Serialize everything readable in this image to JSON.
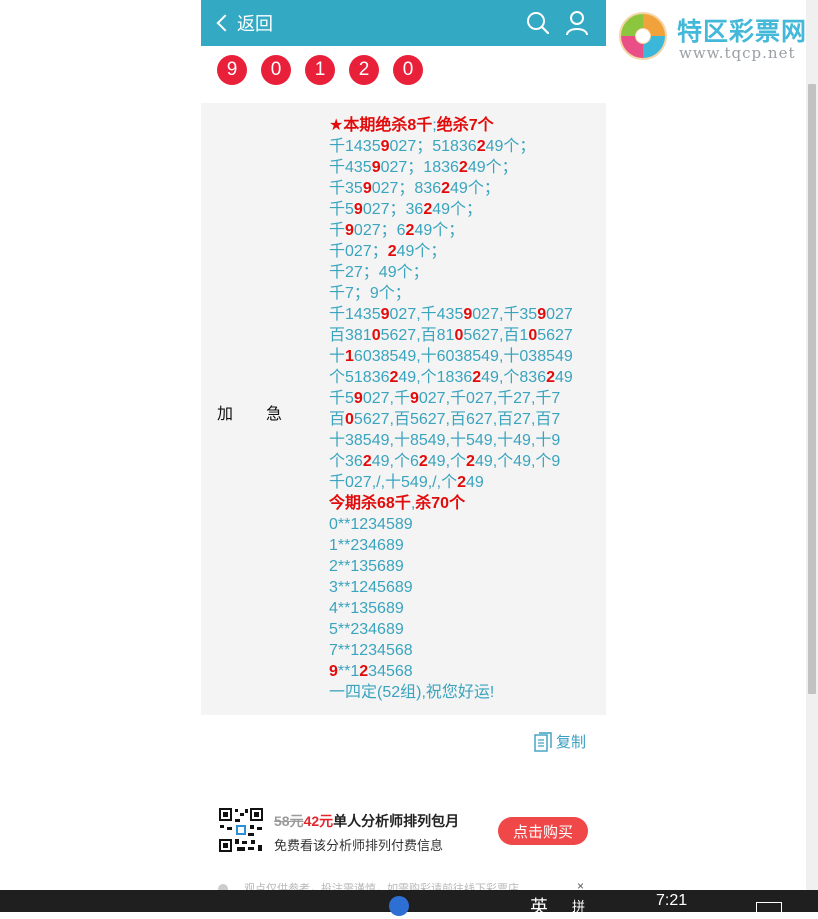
{
  "header": {
    "back_label": "返回",
    "bg_color": "#33a9c4"
  },
  "logo": {
    "name": "特区彩票网",
    "url": "www.tqcp.net"
  },
  "numbers": [
    "9",
    "0",
    "1",
    "2",
    "0"
  ],
  "label": [
    "加",
    "急"
  ],
  "lines": [
    [
      {
        "t": "★本期绝杀8千",
        "c": "hl"
      },
      {
        "t": ";"
      },
      {
        "t": "绝杀7个",
        "c": "hl"
      }
    ],
    [
      {
        "t": "千1435"
      },
      {
        "t": "9",
        "c": "red"
      },
      {
        "t": "027；51836"
      },
      {
        "t": "2",
        "c": "red"
      },
      {
        "t": "49个；"
      }
    ],
    [
      {
        "t": "千435"
      },
      {
        "t": "9",
        "c": "red"
      },
      {
        "t": "027；1836"
      },
      {
        "t": "2",
        "c": "red"
      },
      {
        "t": "49个；"
      }
    ],
    [
      {
        "t": "千35"
      },
      {
        "t": "9",
        "c": "red"
      },
      {
        "t": "027；836"
      },
      {
        "t": "2",
        "c": "red"
      },
      {
        "t": "49个；"
      }
    ],
    [
      {
        "t": "千5"
      },
      {
        "t": "9",
        "c": "red"
      },
      {
        "t": "027；36"
      },
      {
        "t": "2",
        "c": "red"
      },
      {
        "t": "49个；"
      }
    ],
    [
      {
        "t": "千"
      },
      {
        "t": "9",
        "c": "red"
      },
      {
        "t": "027；6"
      },
      {
        "t": "2",
        "c": "red"
      },
      {
        "t": "49个；"
      }
    ],
    [
      {
        "t": "千027；"
      },
      {
        "t": "2",
        "c": "red"
      },
      {
        "t": "49个；"
      }
    ],
    [
      {
        "t": "千27；49个；"
      }
    ],
    [
      {
        "t": "千7；9个；"
      }
    ],
    [
      {
        "t": "千1435"
      },
      {
        "t": "9",
        "c": "red"
      },
      {
        "t": "027,千435"
      },
      {
        "t": "9",
        "c": "red"
      },
      {
        "t": "027,千35"
      },
      {
        "t": "9",
        "c": "red"
      },
      {
        "t": "027"
      }
    ],
    [
      {
        "t": "百381"
      },
      {
        "t": "0",
        "c": "red"
      },
      {
        "t": "5627,百81"
      },
      {
        "t": "0",
        "c": "red"
      },
      {
        "t": "5627,百1"
      },
      {
        "t": "0",
        "c": "red"
      },
      {
        "t": "5627"
      }
    ],
    [
      {
        "t": "十"
      },
      {
        "t": "1",
        "c": "red"
      },
      {
        "t": "6038549,十6038549,十038549"
      }
    ],
    [
      {
        "t": "个51836"
      },
      {
        "t": "2",
        "c": "red"
      },
      {
        "t": "49,个1836"
      },
      {
        "t": "2",
        "c": "red"
      },
      {
        "t": "49,个836"
      },
      {
        "t": "2",
        "c": "red"
      },
      {
        "t": "49"
      }
    ],
    [
      {
        "t": "千5"
      },
      {
        "t": "9",
        "c": "red"
      },
      {
        "t": "027,千"
      },
      {
        "t": "9",
        "c": "red"
      },
      {
        "t": "027,千027,千27,千7"
      }
    ],
    [
      {
        "t": "百"
      },
      {
        "t": "0",
        "c": "red"
      },
      {
        "t": "5627,百5627,百627,百27,百7"
      }
    ],
    [
      {
        "t": "十38549,十8549,十549,十49,十9"
      }
    ],
    [
      {
        "t": "个36"
      },
      {
        "t": "2",
        "c": "red"
      },
      {
        "t": "49,个6"
      },
      {
        "t": "2",
        "c": "red"
      },
      {
        "t": "49,个"
      },
      {
        "t": "2",
        "c": "red"
      },
      {
        "t": "49,个49,个9"
      }
    ],
    [
      {
        "t": "千027,/,十549,/,个"
      },
      {
        "t": "2",
        "c": "red"
      },
      {
        "t": "49"
      }
    ],
    [
      {
        "t": "今期杀68千",
        "c": "hl"
      },
      {
        "t": ","
      },
      {
        "t": "杀70个",
        "c": "hl"
      }
    ],
    [
      {
        "t": "0**1234589"
      }
    ],
    [
      {
        "t": "1**234689"
      }
    ],
    [
      {
        "t": "2**135689"
      }
    ],
    [
      {
        "t": "3**1245689"
      }
    ],
    [
      {
        "t": "4**135689"
      }
    ],
    [
      {
        "t": "5**234689"
      }
    ],
    [
      {
        "t": "7**1234568"
      }
    ],
    [
      {
        "t": "9",
        "c": "red"
      },
      {
        "t": "**1"
      },
      {
        "t": "2",
        "c": "red"
      },
      {
        "t": "34568"
      }
    ],
    [
      {
        "t": "一四定(52组),祝您好运!"
      }
    ]
  ],
  "copy_label": "复制",
  "promo": {
    "old_price": "58元",
    "new_price": "42元",
    "title": "单人分析师排列包月",
    "subtitle": "免费看该分析师排列付费信息",
    "buy_label": "点击购买"
  },
  "notice": {
    "text": "观点仅供参考，投注需谨慎，如需购彩请前往线下彩票店",
    "close": "×"
  },
  "taskbar": {
    "ime1": "英",
    "ime2": "拼",
    "time": "7:21"
  }
}
